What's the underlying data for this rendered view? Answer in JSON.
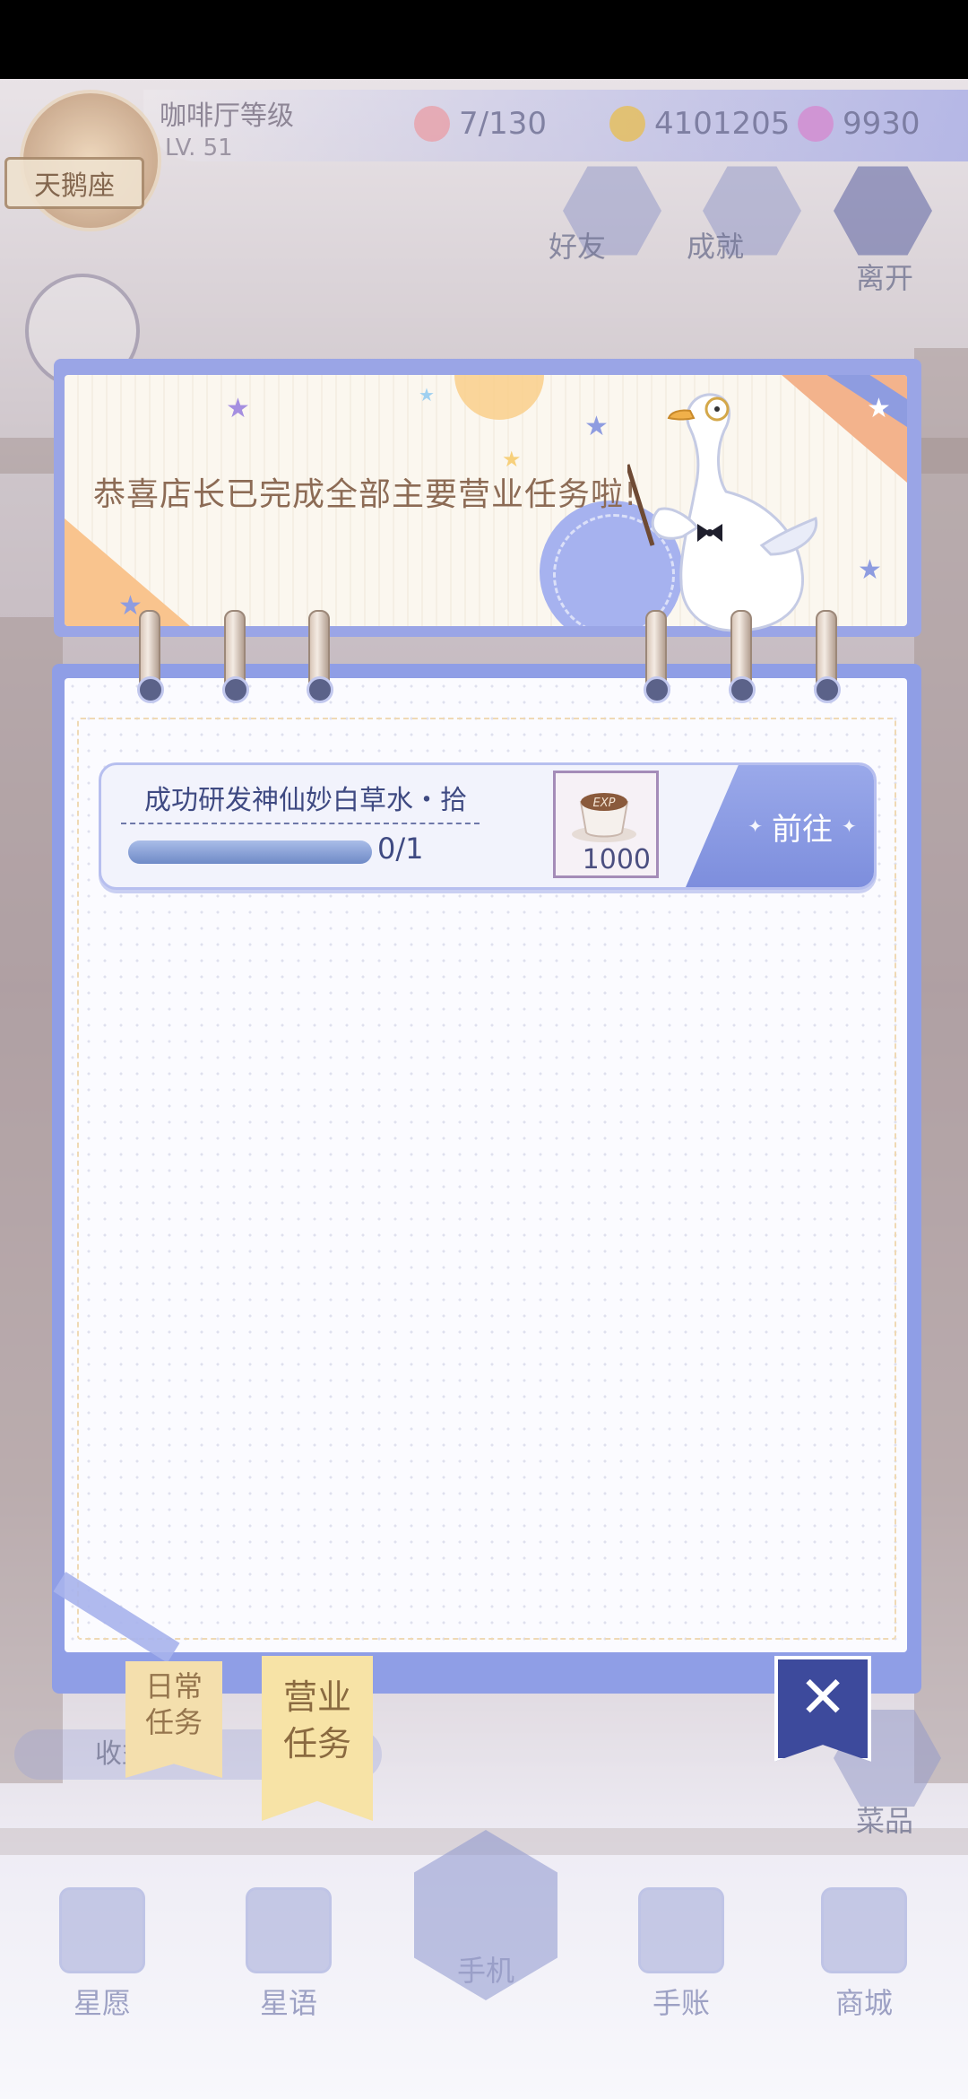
{
  "hud": {
    "cafe_level_title": "咖啡厅等级",
    "level": "LV. 51",
    "emblem_name": "天鹅座",
    "stamina": "7/130",
    "coins": "4101205",
    "gems": "9930",
    "buttons": {
      "friends": "好友",
      "achievements": "成就",
      "leave": "离开"
    }
  },
  "banner": {
    "message": "恭喜店长已完成全部主要营业任务啦!"
  },
  "task": {
    "name": "成功研发神仙妙白草水・拾",
    "progress_text": "0/1",
    "progress_fraction": 0,
    "reward_icon": "exp-coffee-icon",
    "reward_value": "1000",
    "go_label": "前往"
  },
  "tabs": {
    "daily": "日常\n任务",
    "business": "营业\n任务"
  },
  "background": {
    "income_label": "收益",
    "menu_label": "菜品"
  },
  "bottom_nav": {
    "wish": "星愿",
    "star_words": "星语",
    "phone": "手机",
    "journal": "手账",
    "shop": "商城"
  },
  "colors": {
    "frame": "#8f9ee6",
    "accent_text": "#3f4a82",
    "banner_text": "#8c6b55",
    "close": "#3d4a9c"
  }
}
